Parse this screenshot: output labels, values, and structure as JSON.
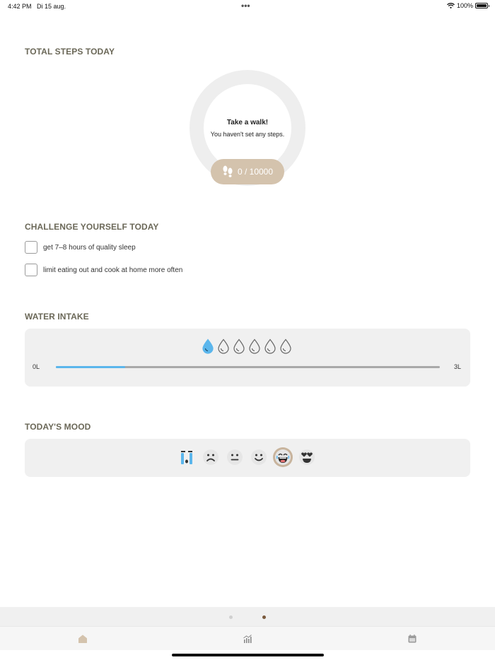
{
  "status_bar": {
    "time": "4:42 PM",
    "date": "Di 15 aug.",
    "dots": "•••",
    "battery": "100%"
  },
  "steps": {
    "section_title": "TOTAL STEPS TODAY",
    "ring_title": "Take a walk!",
    "ring_subtitle": "You haven't set any steps.",
    "count_label": "0 / 10000",
    "current": 0,
    "goal": 10000
  },
  "challenges": {
    "section_title": "CHALLENGE YOURSELF TODAY",
    "items": [
      {
        "label": "get 7–8 hours of quality sleep",
        "checked": false
      },
      {
        "label": "limit eating out and cook at home more often",
        "checked": false
      }
    ]
  },
  "water": {
    "section_title": "WATER INTAKE",
    "drops_total": 6,
    "drops_filled": 1,
    "min_label": "0L",
    "max_label": "3L",
    "level_fraction": 0.18
  },
  "mood": {
    "section_title": "TODAY'S MOOD",
    "options": [
      "crying-face-icon",
      "frowning-face-icon",
      "neutral-face-icon",
      "smiling-face-icon",
      "laughing-face-icon",
      "heart-eyes-face-icon"
    ],
    "selected_index": 4
  },
  "pager": {
    "pages": 2,
    "current": 1
  },
  "tabs": [
    "home-icon",
    "stats-icon",
    "calendar-icon"
  ],
  "colors": {
    "accent": "#d4c3ad",
    "water": "#5bb6ec",
    "title": "#6b6858",
    "pager_active": "#7a5a3c",
    "pager_inactive": "#d0d0d0"
  }
}
